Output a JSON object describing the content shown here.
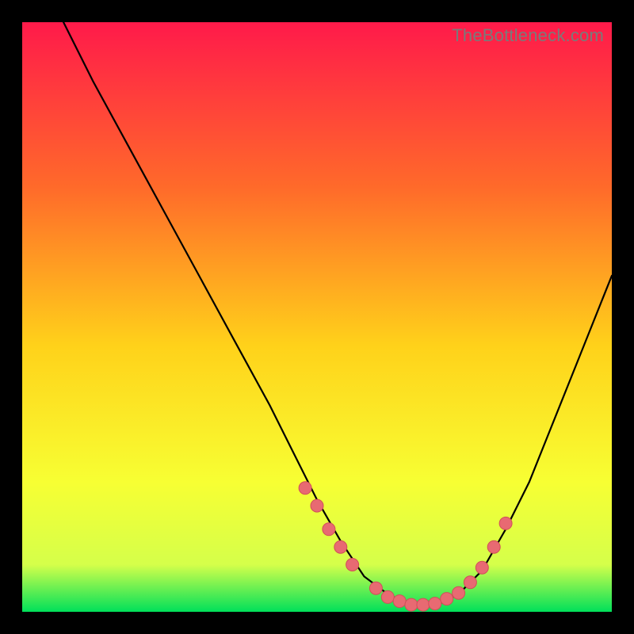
{
  "watermark": "TheBottleneck.com",
  "colors": {
    "grad_top": "#ff1a4a",
    "grad_q1": "#ff6a2a",
    "grad_mid": "#ffd21a",
    "grad_q3": "#f7ff33",
    "grad_near_bottom": "#d5ff4a",
    "grad_bottom": "#00e05a",
    "curve": "#000000",
    "marker_fill": "#e86a72",
    "marker_stroke": "#d14f58"
  },
  "chart_data": {
    "type": "line",
    "title": "",
    "xlabel": "",
    "ylabel": "",
    "xlim": [
      0,
      100
    ],
    "ylim": [
      0,
      100
    ],
    "series": [
      {
        "name": "bottleneck-curve",
        "x": [
          7,
          12,
          18,
          24,
          30,
          36,
          42,
          46,
          50,
          54,
          58,
          62,
          66,
          70,
          74,
          78,
          82,
          86,
          90,
          94,
          98,
          100
        ],
        "y": [
          100,
          90,
          79,
          68,
          57,
          46,
          35,
          27,
          19,
          12,
          6,
          3,
          1,
          1,
          3,
          7,
          14,
          22,
          32,
          42,
          52,
          57
        ]
      }
    ],
    "markers": {
      "name": "highlight-points",
      "x": [
        48,
        50,
        52,
        54,
        56,
        60,
        62,
        64,
        66,
        68,
        70,
        72,
        74,
        76,
        78,
        80,
        82
      ],
      "y": [
        21,
        18,
        14,
        11,
        8,
        4,
        2.5,
        1.8,
        1.2,
        1.2,
        1.4,
        2.2,
        3.2,
        5,
        7.5,
        11,
        15
      ]
    }
  }
}
